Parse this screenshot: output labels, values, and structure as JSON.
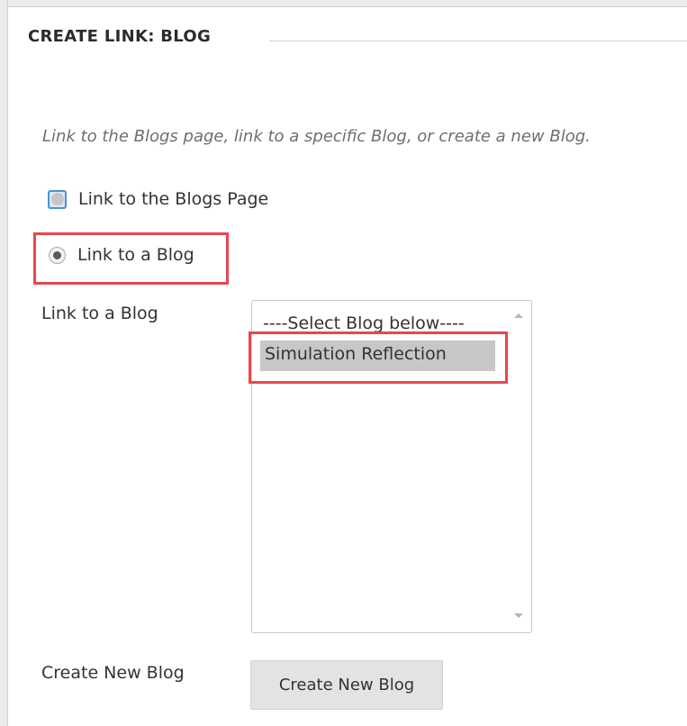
{
  "section": {
    "title": "CREATE LINK: BLOG",
    "instructions": "Link to the Blogs page, link to a specific Blog, or create a new Blog."
  },
  "link_options": [
    {
      "label": "Link to the Blogs Page",
      "selected": false
    },
    {
      "label": "Link to a Blog",
      "selected": true
    }
  ],
  "blog_select": {
    "label": "Link to a Blog",
    "options": [
      "----Select Blog below----",
      "Simulation Reflection"
    ],
    "selected_option": "Simulation Reflection"
  },
  "create_new": {
    "label": "Create New Blog",
    "button_label": "Create New Blog"
  },
  "colors": {
    "highlight": "#e8474c",
    "selected_option_bg": "#c7c7c7",
    "focus_blue": "#4a90d9"
  }
}
